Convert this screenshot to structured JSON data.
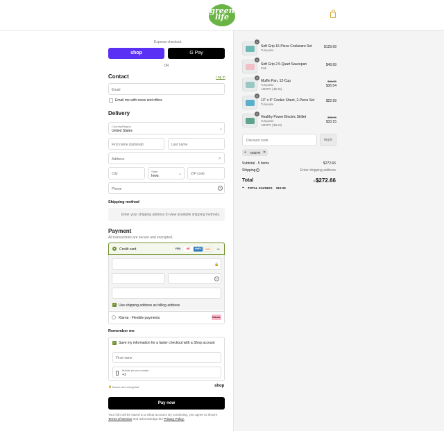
{
  "brand": {
    "logo_line1": "green",
    "logo_line2": "life",
    "accent": "#6ab445"
  },
  "express": {
    "label": "Express checkout",
    "shop_label": "shop",
    "gpay_label": "G Pay",
    "or": "OR"
  },
  "contact": {
    "title": "Contact",
    "login": "Log in",
    "email_ph": "Email",
    "news_label": "Email me with news and offers"
  },
  "delivery": {
    "title": "Delivery",
    "country_label": "Country/Region",
    "country_value": "United States",
    "first_ph": "First name (optional)",
    "last_ph": "Last name",
    "address_ph": "Address",
    "city_ph": "City",
    "state_label": "State",
    "state_value": "Iowa",
    "zip_ph": "ZIP code",
    "phone_ph": "Phone"
  },
  "shipping": {
    "title": "Shipping method",
    "note": "Enter your shipping address to view available shipping methods."
  },
  "payment": {
    "title": "Payment",
    "subtitle": "All transactions are secure and encrypted.",
    "credit_label": "Credit card",
    "cards": [
      "VISA",
      "MC",
      "AMEX",
      "DISC"
    ],
    "more": "+4",
    "billing_label": "Use shipping address as billing address",
    "klarna_label": "Klarna - Flexible payments",
    "klarna_badge": "Klarna."
  },
  "remember": {
    "title": "Remember me",
    "save_label": "Save my information for a faster checkout with a Shop account",
    "first_ph": "First name",
    "mobile_label": "Mobile phone number",
    "mobile_value": "+1",
    "secure": "Secure and encrypted",
    "shop": "shop"
  },
  "pay": {
    "label": "Pay now",
    "legal1": "Your info will be saved to a Shop account. By continuing, you agree to Shop's",
    "terms": "Terms of Service",
    "legal2": "and acknowledge the",
    "privacy": "Privacy Policy."
  },
  "cart": {
    "items": [
      {
        "qty": "1",
        "title": "Soft Grip 16-Piece Cookware Set",
        "variant": "Turquoise",
        "price": "$129.99"
      },
      {
        "qty": "1",
        "title": "Soft Grip 2.5-Quart Saucepan",
        "variant": "Pink",
        "price": "$49.99"
      },
      {
        "qty": "1",
        "title": "Muffin Pan, 12-Cup",
        "variant": "Turquoise",
        "discount": "AMZFR (-$6.45)",
        "old_price": "$42.99",
        "price": "$36.54"
      },
      {
        "qty": "1",
        "title": "13\" x 9\" Cookie Sheet, 2-Piece Set",
        "variant": "Turquoise",
        "price": "$22.99"
      },
      {
        "qty": "1",
        "title": "Healthy Power Electric Skillet",
        "variant": "Turquoise",
        "discount": "AMZFR (-$5.84)",
        "old_price": "$38.99",
        "price": "$33.15"
      }
    ],
    "discount_ph": "Discount code",
    "apply": "Apply",
    "code_tag": "AMZFR",
    "subtotal_label": "Subtotal · 5 items",
    "subtotal": "$272.66",
    "shipping_label": "Shipping",
    "shipping_value": "Enter shipping address",
    "total_label": "Total",
    "currency": "USD",
    "total": "$272.66",
    "savings_label": "TOTAL SAVINGS",
    "savings": "$12.29"
  }
}
